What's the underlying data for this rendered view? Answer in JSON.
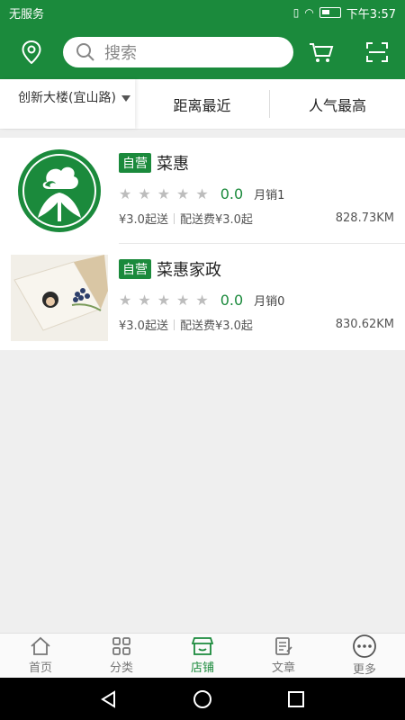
{
  "status_bar": {
    "carrier": "无服务",
    "time": "下午3:57"
  },
  "header": {
    "search_placeholder": "搜索"
  },
  "filter": {
    "location": "创新大楼(宜山路)",
    "sort_distance": "距离最近",
    "sort_popularity": "人气最高"
  },
  "shops": [
    {
      "badge": "自营",
      "name": "菜惠",
      "rating": "0.0",
      "monthly_sales": "月销1",
      "min_order": "¥3.0起送",
      "delivery_fee": "配送费¥3.0起",
      "distance": "828.73KM"
    },
    {
      "badge": "自营",
      "name": "菜惠家政",
      "rating": "0.0",
      "monthly_sales": "月销0",
      "min_order": "¥3.0起送",
      "delivery_fee": "配送费¥3.0起",
      "distance": "830.62KM"
    }
  ],
  "bottom_nav": {
    "home": "首页",
    "category": "分类",
    "shop": "店铺",
    "article": "文章",
    "more": "更多"
  },
  "colors": {
    "brand_green": "#1b8a3c"
  }
}
